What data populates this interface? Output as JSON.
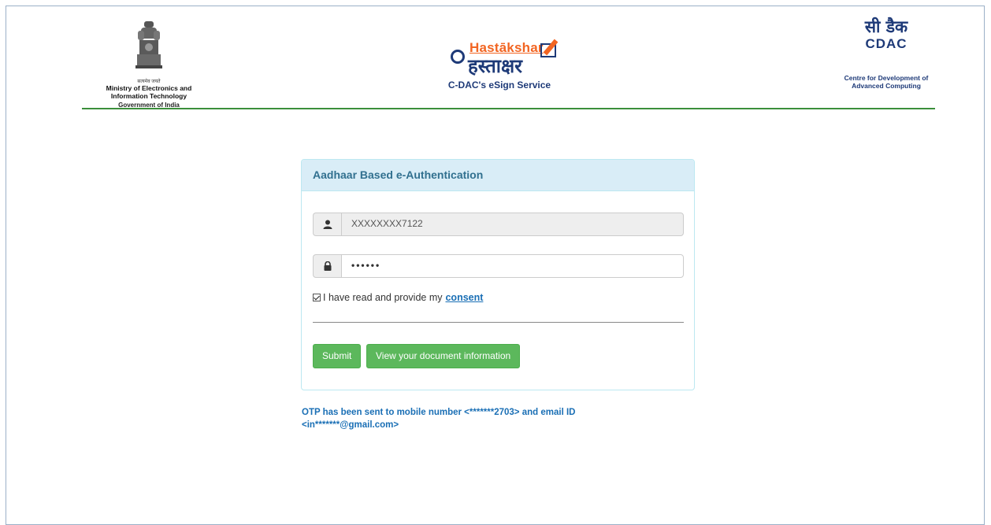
{
  "header": {
    "gov": {
      "motto": "सत्यमेव जयते",
      "line1": "Ministry of Electronics and",
      "line2": "Information Technology",
      "line3": "Government of India"
    },
    "esign": {
      "top": "Hastākshar",
      "hindi": "हस्ताक्षर",
      "caption": "C-DAC's eSign Service"
    },
    "cdac": {
      "hindi": "सी डैक",
      "name": "CDAC",
      "line1": "Centre for Development of",
      "line2": "Advanced Computing"
    }
  },
  "panel": {
    "title": "Aadhaar Based e-Authentication",
    "aadhaar_value": "XXXXXXXX7122",
    "otp_masked": "••••••",
    "consent_text": "I have read and provide my",
    "consent_link": "consent",
    "submit_label": "Submit",
    "view_doc_label": "View your document information"
  },
  "message": {
    "otp_line1": "OTP has been sent to mobile number <*******2703> and email ID",
    "otp_line2": "<in*******@gmail.com>"
  },
  "colors": {
    "panel_heading_bg": "#d9edf7",
    "button_green": "#5cb85c",
    "link_blue": "#1a6fb5",
    "header_rule": "#3b8f3b"
  }
}
